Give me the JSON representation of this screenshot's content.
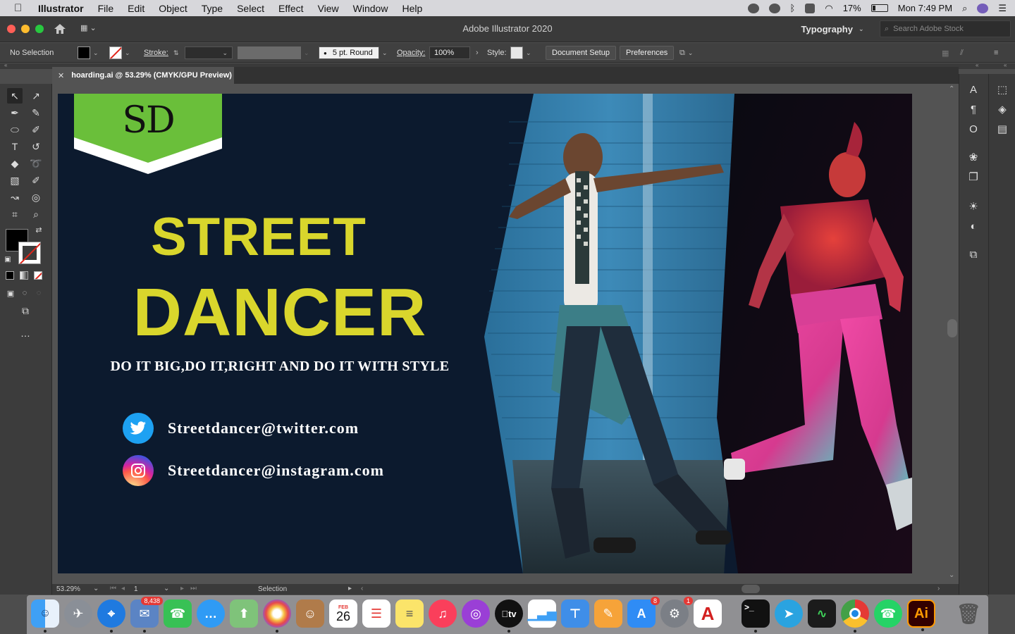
{
  "menubar": {
    "app": "Illustrator",
    "items": [
      "File",
      "Edit",
      "Object",
      "Type",
      "Select",
      "Effect",
      "View",
      "Window",
      "Help"
    ],
    "battery": "17%",
    "clock": "Mon 7:49 PM"
  },
  "titlebar": {
    "title": "Adobe Illustrator 2020",
    "workspace": "Typography",
    "search_placeholder": "Search Adobe Stock"
  },
  "controlbar": {
    "selection": "No Selection",
    "stroke_label": "Stroke:",
    "brush": "5 pt. Round",
    "opacity_label": "Opacity:",
    "opacity_value": "100%",
    "style_label": "Style:",
    "document_setup": "Document Setup",
    "preferences": "Preferences"
  },
  "document": {
    "tab": "hoarding.ai @ 53.29% (CMYK/GPU Preview)"
  },
  "artwork": {
    "logo_text": "SD",
    "headline_1": "STREET",
    "headline_2": "DANCER",
    "tagline": "DO IT BIG,DO IT,RIGHT AND DO IT WITH STYLE",
    "twitter": "Streetdancer@twitter.com",
    "instagram": "Streetdancer@instagram.com",
    "colors": {
      "background": "#0c1a2e",
      "headline": "#d9d62c",
      "logo_green": "#6abf3a"
    }
  },
  "statusbar": {
    "zoom": "53.29%",
    "artboard": "1",
    "mode": "Selection"
  },
  "dock": {
    "mail_badge": "8,438",
    "calendar_month": "FEB",
    "calendar_day": "26",
    "appstore_badge": "8",
    "prefs_badge": "1",
    "illustrator_label": "Ai"
  }
}
